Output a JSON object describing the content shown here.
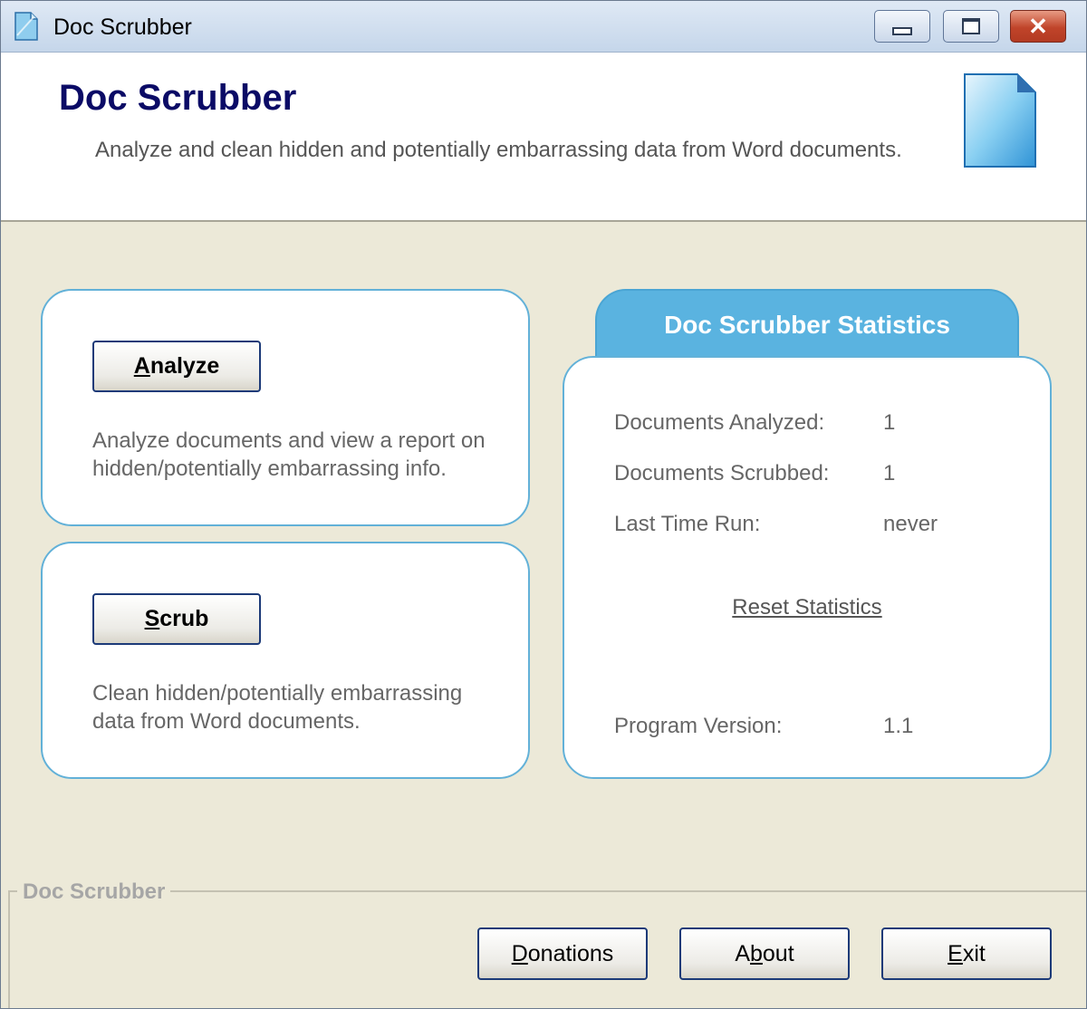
{
  "window": {
    "title": "Doc Scrubber",
    "controls": {
      "minimize": "minimize",
      "maximize": "maximize",
      "close": "close"
    }
  },
  "header": {
    "title": "Doc Scrubber",
    "subtitle": "Analyze and clean hidden and potentially embarrassing data from Word documents.",
    "icon": "document-icon"
  },
  "analyze": {
    "button_accel": "A",
    "button_rest": "nalyze",
    "description": "Analyze documents and view a report on hidden/potentially embarrassing info."
  },
  "scrub": {
    "button_accel": "S",
    "button_rest": "crub",
    "description": "Clean hidden/potentially embarrassing data from Word documents."
  },
  "statistics": {
    "title": "Doc Scrubber Statistics",
    "rows": [
      {
        "label": "Documents Analyzed:",
        "value": "1"
      },
      {
        "label": "Documents Scrubbed:",
        "value": "1"
      },
      {
        "label": "Last Time Run:",
        "value": "never"
      }
    ],
    "reset_link": "Reset Statistics",
    "version_label": "Program Version:",
    "version_value": "1.1"
  },
  "footer": {
    "group_label": "Doc Scrubber",
    "donations": {
      "accel": "D",
      "rest": "onations"
    },
    "about": {
      "before": "A",
      "accel": "b",
      "rest": "out"
    },
    "exit": {
      "accel": "E",
      "rest": "xit"
    }
  },
  "colors": {
    "accent_blue": "#5ab3e0",
    "panel_border": "#62b1d8",
    "header_title": "#0b0b66",
    "background": "#ece9d8"
  }
}
